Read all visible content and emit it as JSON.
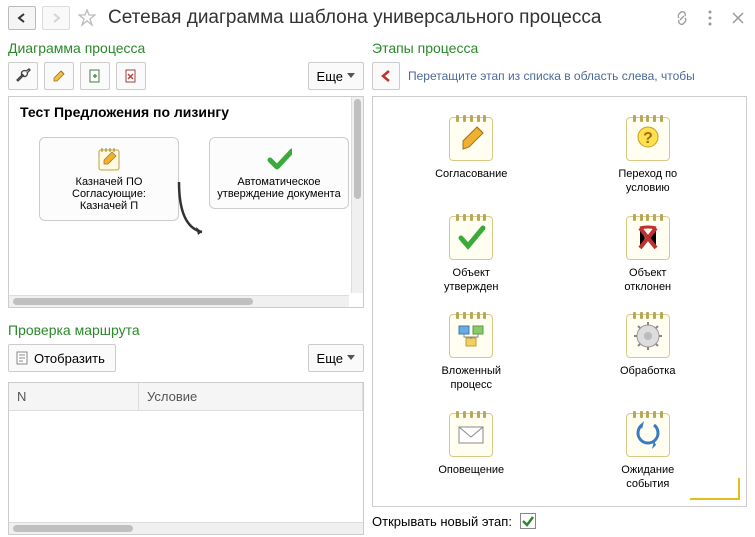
{
  "title": "Сетевая диаграмма шаблона универсального процесса",
  "sections": {
    "diagram": "Диаграмма процесса",
    "stages": "Этапы процесса",
    "route": "Проверка маршрута"
  },
  "buttons": {
    "more": "Еще",
    "display": "Отобразить"
  },
  "diagram": {
    "title": "Тест Предложения по лизингу",
    "node1": "Казначей ПО\nСогласующие: Казначей П",
    "node1_l1": "Казначей ПО",
    "node1_l2": "Согласующие:",
    "node1_l3": "Казначей П",
    "node2_l1": "Автоматическое",
    "node2_l2": "утверждение документа"
  },
  "table": {
    "col_n": "N",
    "col_cond": "Условие"
  },
  "hint": "Перетащите этап из списка в область слева, чтобы",
  "stages_list": [
    {
      "key": "approval",
      "label": "Согласование"
    },
    {
      "key": "condition",
      "label": "Переход по условию"
    },
    {
      "key": "approved",
      "label": "Объект утвержден"
    },
    {
      "key": "rejected",
      "label": "Объект отклонен"
    },
    {
      "key": "nested",
      "label": "Вложенный процесс"
    },
    {
      "key": "processing",
      "label": "Обработка"
    },
    {
      "key": "notification",
      "label": "Оповещение"
    },
    {
      "key": "waiting",
      "label": "Ожидание события"
    }
  ],
  "footer": {
    "open_new_stage": "Открывать новый этап:",
    "checked": true
  }
}
